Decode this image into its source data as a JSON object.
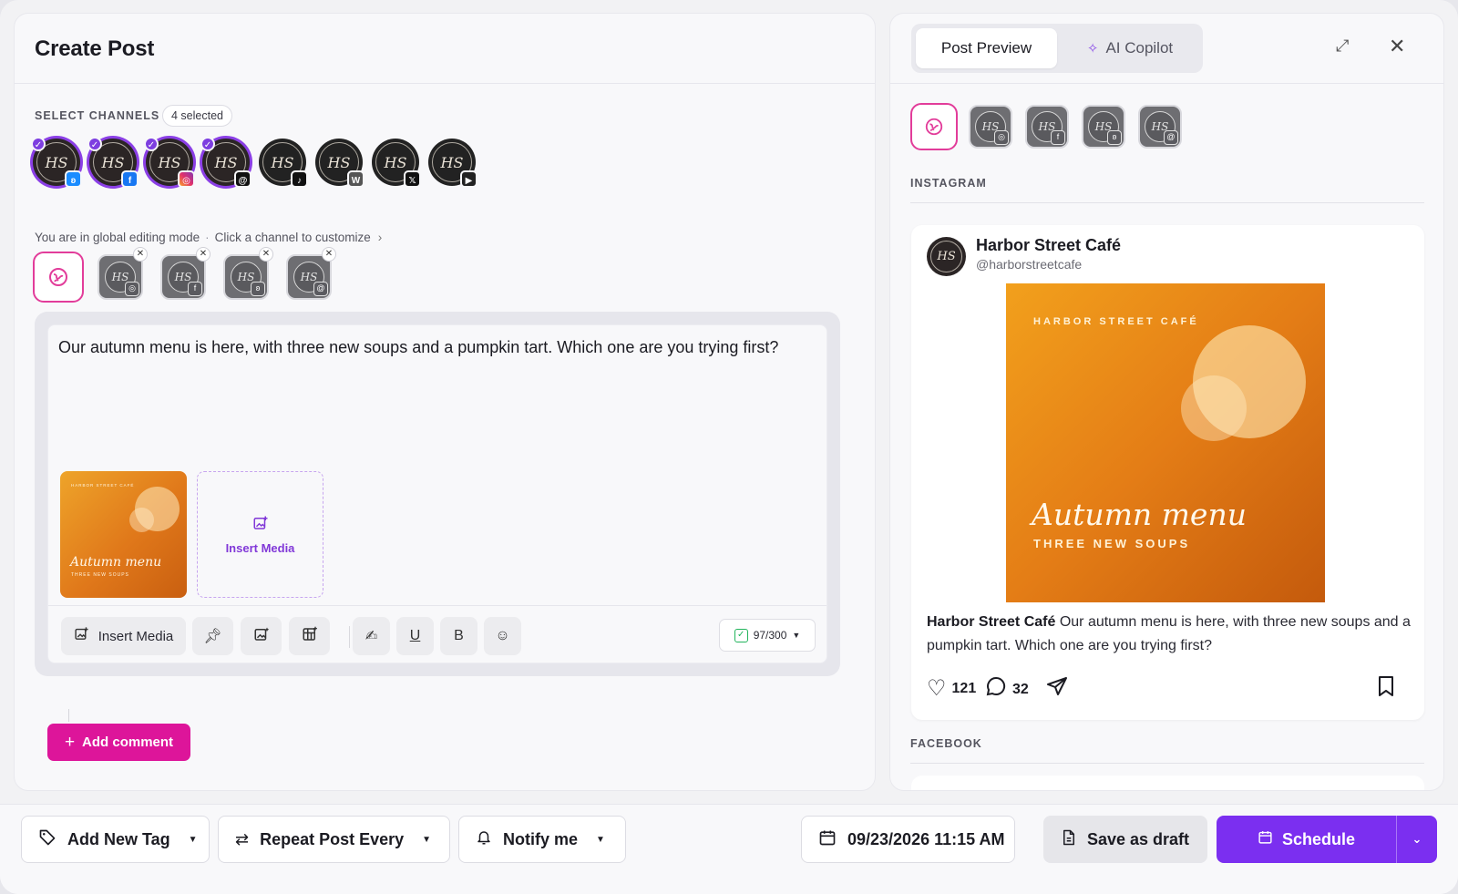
{
  "left": {
    "title": "Create Post",
    "select_channels_label": "SELECT CHANNELS",
    "selected_count": "4 selected",
    "mode_text": "You are in global editing mode",
    "mode_link": "Click a channel to customize",
    "channels": [
      {
        "initials": "HS",
        "network": "bluesky",
        "selected": true
      },
      {
        "initials": "HS",
        "network": "facebook",
        "selected": true
      },
      {
        "initials": "HS",
        "network": "instagram",
        "selected": true
      },
      {
        "initials": "HS",
        "network": "threads",
        "selected": true
      },
      {
        "initials": "HS",
        "network": "tiktok",
        "selected": false
      },
      {
        "initials": "HS",
        "network": "wordpress",
        "selected": false
      },
      {
        "initials": "HS",
        "network": "x",
        "selected": false
      },
      {
        "initials": "HS",
        "network": "youtube",
        "selected": false
      }
    ],
    "customize_tiles": [
      {
        "initials": "HS",
        "network": "instagram"
      },
      {
        "initials": "HS",
        "network": "facebook"
      },
      {
        "initials": "HS",
        "network": "bluesky"
      },
      {
        "initials": "HS",
        "network": "threads"
      }
    ],
    "post_text": "Our autumn menu is here, with three new soups and a pumpkin tart. Which one are you trying first?",
    "media_thumb": {
      "brand": "HARBOR STREET CAFÉ",
      "headline": "Autumn menu",
      "sub": "THREE NEW SOUPS"
    },
    "insert_media_box_label": "Insert Media",
    "toolbar": {
      "insert_media_label": "Insert Media",
      "char_count": "97/300"
    },
    "add_comment_label": "Add comment"
  },
  "right": {
    "tabs": [
      {
        "label": "Post Preview",
        "active": true
      },
      {
        "label": "AI Copilot",
        "active": false
      }
    ],
    "section_instagram": "INSTAGRAM",
    "section_facebook": "FACEBOOK",
    "preview": {
      "account_name": "Harbor Street Café",
      "handle": "@harborstreetcafe",
      "avatar_initials": "HS",
      "image": {
        "brand": "HARBOR STREET CAFÉ",
        "headline": "Autumn menu",
        "sub": "THREE NEW SOUPS"
      },
      "caption_name": "Harbor Street Café",
      "caption_text": " Our autumn menu is here, with three new soups and a pumpkin tart. Which one are you trying first?",
      "likes": "121",
      "comments": "32"
    }
  },
  "bottom": {
    "add_tag_label": "Add New Tag",
    "repeat_label": "Repeat Post Every",
    "notify_label": "Notify me",
    "datetime": "09/23/2026 11:15 AM",
    "save_draft_label": "Save as draft",
    "schedule_label": "Schedule"
  },
  "colors": {
    "accent_purple": "#7b2ff0",
    "accent_pink": "#dd159a",
    "selected_ring": "#8b3fe6"
  }
}
